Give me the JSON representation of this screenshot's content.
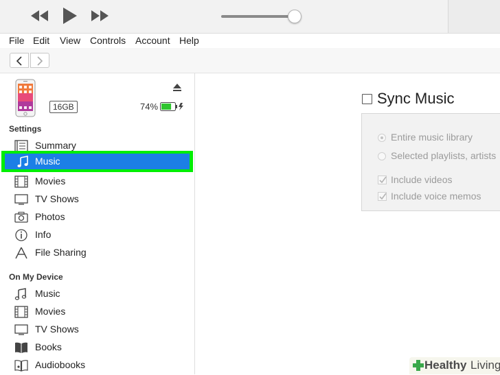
{
  "menubar": {
    "items": [
      "File",
      "Edit",
      "View",
      "Controls",
      "Account",
      "Help"
    ]
  },
  "playback": {
    "rewind_icon": "rewind-icon",
    "play_icon": "play-icon",
    "fast_forward_icon": "fast-forward-icon",
    "volume_level": 0.9
  },
  "device": {
    "capacity": "16GB",
    "battery_percent": "74%",
    "battery_level": 0.74,
    "battery_color": "#2ec52e"
  },
  "sidebar": {
    "settings_header": "Settings",
    "settings_items": [
      {
        "label": "Summary",
        "icon": "summary-icon"
      },
      {
        "label": "Music",
        "icon": "music-note-icon",
        "selected": true
      },
      {
        "label": "Movies",
        "icon": "film-icon"
      },
      {
        "label": "TV Shows",
        "icon": "tv-icon"
      },
      {
        "label": "Photos",
        "icon": "camera-icon"
      },
      {
        "label": "Info",
        "icon": "info-icon"
      },
      {
        "label": "File Sharing",
        "icon": "file-sharing-icon"
      }
    ],
    "device_header": "On My Device",
    "device_items": [
      {
        "label": "Music",
        "icon": "music-note-icon"
      },
      {
        "label": "Movies",
        "icon": "film-icon"
      },
      {
        "label": "TV Shows",
        "icon": "tv-icon"
      },
      {
        "label": "Books",
        "icon": "book-icon"
      },
      {
        "label": "Audiobooks",
        "icon": "audiobook-icon"
      }
    ]
  },
  "main": {
    "sync_title": "Sync Music",
    "options": {
      "entire_library": "Entire music library",
      "selected_playlists": "Selected playlists, artists",
      "include_videos": "Include videos",
      "include_voice_memos": "Include voice memos"
    }
  },
  "watermark": {
    "brand_bold": "Healthy",
    "brand_light": "Living"
  },
  "colors": {
    "selection_highlight": "#1c7fe6",
    "annotation_outline": "#00ee00"
  }
}
